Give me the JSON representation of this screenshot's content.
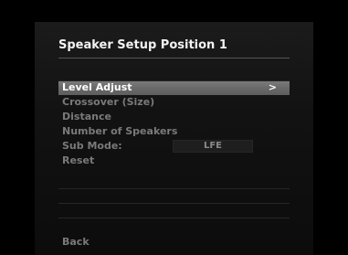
{
  "screen": {
    "title": "Speaker Setup Position 1",
    "menu": [
      {
        "label": "Level Adjust",
        "selected": true,
        "arrow": ">"
      },
      {
        "label": "Crossover (Size)"
      },
      {
        "label": "Distance"
      },
      {
        "label": "Number of Speakers"
      },
      {
        "label": "Sub Mode:",
        "value": "LFE"
      },
      {
        "label": "Reset"
      }
    ],
    "back_label": "Back"
  },
  "colors": {
    "background": "#000000",
    "selected_highlight": "#6e6e6e",
    "title_text": "#f2f2f2",
    "dim_text": "#7a7a7a"
  }
}
